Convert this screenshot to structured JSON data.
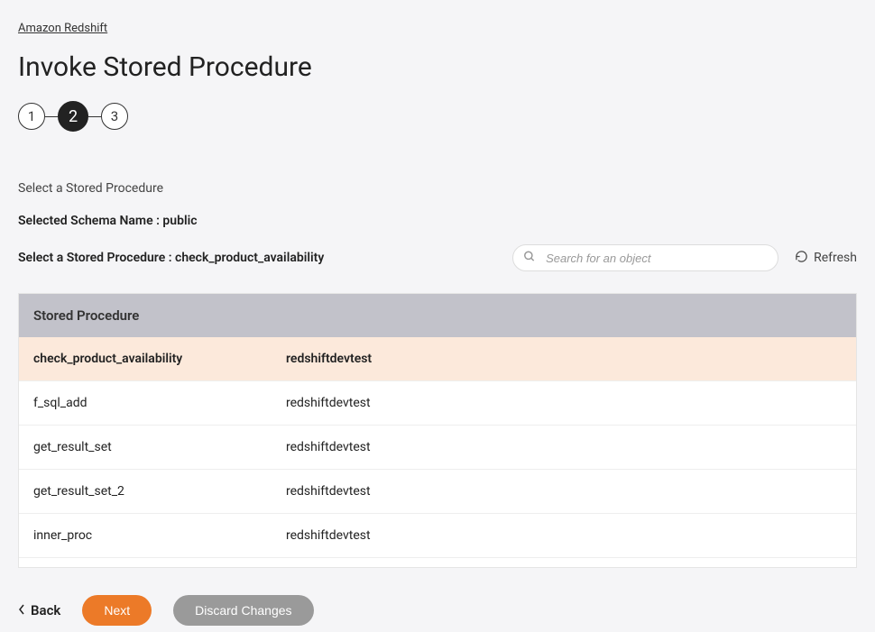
{
  "breadcrumb": "Amazon Redshift",
  "title": "Invoke Stored Procedure",
  "stepper": {
    "steps": [
      "1",
      "2",
      "3"
    ],
    "active": 1
  },
  "section_label": "Select a Stored Procedure",
  "schema_label_prefix": "Selected Schema Name : ",
  "schema_name": "public",
  "select_label_prefix": "Select a Stored Procedure : ",
  "selected_proc": "check_product_availability",
  "search": {
    "placeholder": "Search for an object"
  },
  "refresh_label": "Refresh",
  "table": {
    "header": "Stored Procedure",
    "rows": [
      {
        "name": "check_product_availability",
        "db": "redshiftdevtest",
        "selected": true
      },
      {
        "name": "f_sql_add",
        "db": "redshiftdevtest",
        "selected": false
      },
      {
        "name": "get_result_set",
        "db": "redshiftdevtest",
        "selected": false
      },
      {
        "name": "get_result_set_2",
        "db": "redshiftdevtest",
        "selected": false
      },
      {
        "name": "inner_proc",
        "db": "redshiftdevtest",
        "selected": false
      }
    ]
  },
  "footer": {
    "back": "Back",
    "next": "Next",
    "discard": "Discard Changes"
  }
}
